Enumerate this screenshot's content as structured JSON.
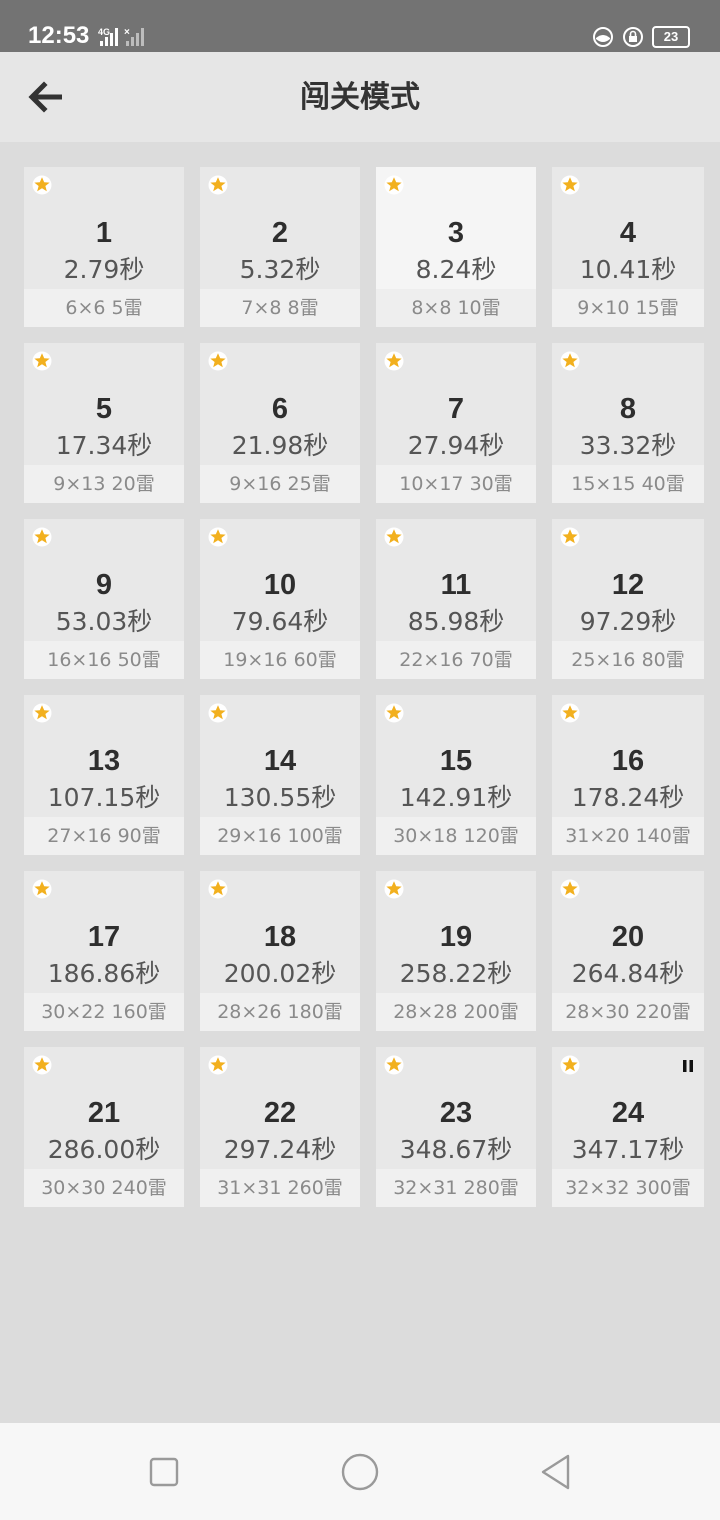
{
  "status_bar": {
    "time": "12:53",
    "network": "4G",
    "battery": "23"
  },
  "header": {
    "title": "闯关模式"
  },
  "levels": [
    {
      "num": "1",
      "time": "2.79秒",
      "info": "6×6  5雷"
    },
    {
      "num": "2",
      "time": "5.32秒",
      "info": "7×8  8雷"
    },
    {
      "num": "3",
      "time": "8.24秒",
      "info": "8×8  10雷"
    },
    {
      "num": "4",
      "time": "10.41秒",
      "info": "9×10  15雷"
    },
    {
      "num": "5",
      "time": "17.34秒",
      "info": "9×13  20雷"
    },
    {
      "num": "6",
      "time": "21.98秒",
      "info": "9×16  25雷"
    },
    {
      "num": "7",
      "time": "27.94秒",
      "info": "10×17  30雷"
    },
    {
      "num": "8",
      "time": "33.32秒",
      "info": "15×15  40雷"
    },
    {
      "num": "9",
      "time": "53.03秒",
      "info": "16×16  50雷"
    },
    {
      "num": "10",
      "time": "79.64秒",
      "info": "19×16  60雷"
    },
    {
      "num": "11",
      "time": "85.98秒",
      "info": "22×16  70雷"
    },
    {
      "num": "12",
      "time": "97.29秒",
      "info": "25×16  80雷"
    },
    {
      "num": "13",
      "time": "107.15秒",
      "info": "27×16  90雷"
    },
    {
      "num": "14",
      "time": "130.55秒",
      "info": "29×16  100雷"
    },
    {
      "num": "15",
      "time": "142.91秒",
      "info": "30×18  120雷"
    },
    {
      "num": "16",
      "time": "178.24秒",
      "info": "31×20  140雷"
    },
    {
      "num": "17",
      "time": "186.86秒",
      "info": "30×22  160雷"
    },
    {
      "num": "18",
      "time": "200.02秒",
      "info": "28×26  180雷"
    },
    {
      "num": "19",
      "time": "258.22秒",
      "info": "28×28  200雷"
    },
    {
      "num": "20",
      "time": "264.84秒",
      "info": "28×30  220雷"
    },
    {
      "num": "21",
      "time": "286.00秒",
      "info": "30×30  240雷"
    },
    {
      "num": "22",
      "time": "297.24秒",
      "info": "31×31  260雷"
    },
    {
      "num": "23",
      "time": "348.67秒",
      "info": "32×31  280雷"
    },
    {
      "num": "24",
      "time": "347.17秒",
      "info": "32×32  300雷"
    }
  ],
  "colors": {
    "star": "#f2b01e",
    "card": "#e8e8e8",
    "card_selected": "#f5f5f5",
    "background": "#dcdcdc"
  }
}
